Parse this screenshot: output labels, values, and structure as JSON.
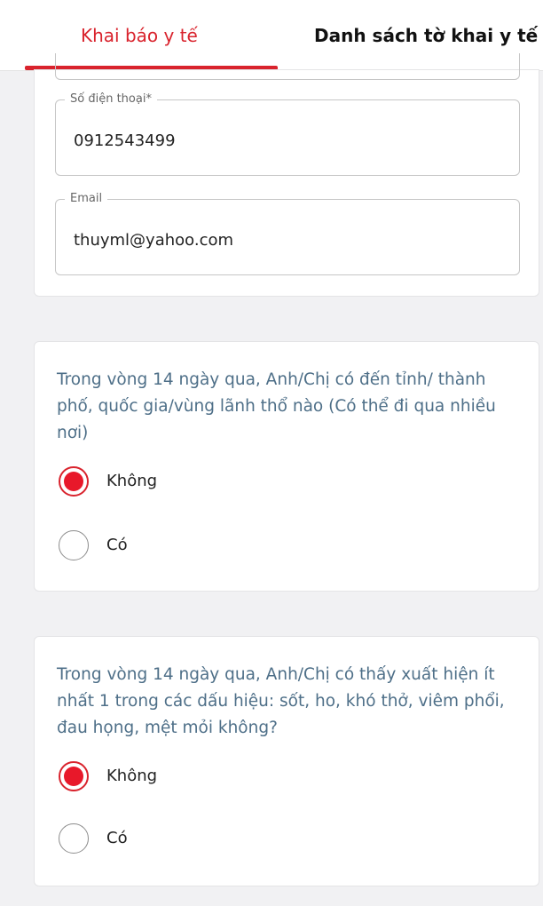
{
  "tabs": {
    "active": "Khai báo y tế",
    "second": "Danh sách tờ khai y tế"
  },
  "form": {
    "phone": {
      "label": "Số điện thoại*",
      "value": "0912543499"
    },
    "email": {
      "label": "Email",
      "value": "thuyml@yahoo.com"
    }
  },
  "questions": [
    {
      "text": "Trong vòng 14 ngày qua, Anh/Chị có đến tỉnh/ thành phố, quốc gia/vùng lãnh thổ nào (Có thể đi qua nhiều nơi)",
      "options": [
        "Không",
        "Có"
      ],
      "selected": "Không"
    },
    {
      "text": "Trong vòng 14 ngày qua, Anh/Chị có thấy xuất hiện ít nhất 1 trong các dấu hiệu: sốt, ho, khó thở, viêm phổi, đau họng, mệt mỏi không?",
      "options": [
        "Không",
        "Có"
      ],
      "selected": "Không"
    }
  ],
  "colors": {
    "accent": "#d9232d",
    "question_text": "#4e6f88",
    "background": "#f1f1f3"
  }
}
